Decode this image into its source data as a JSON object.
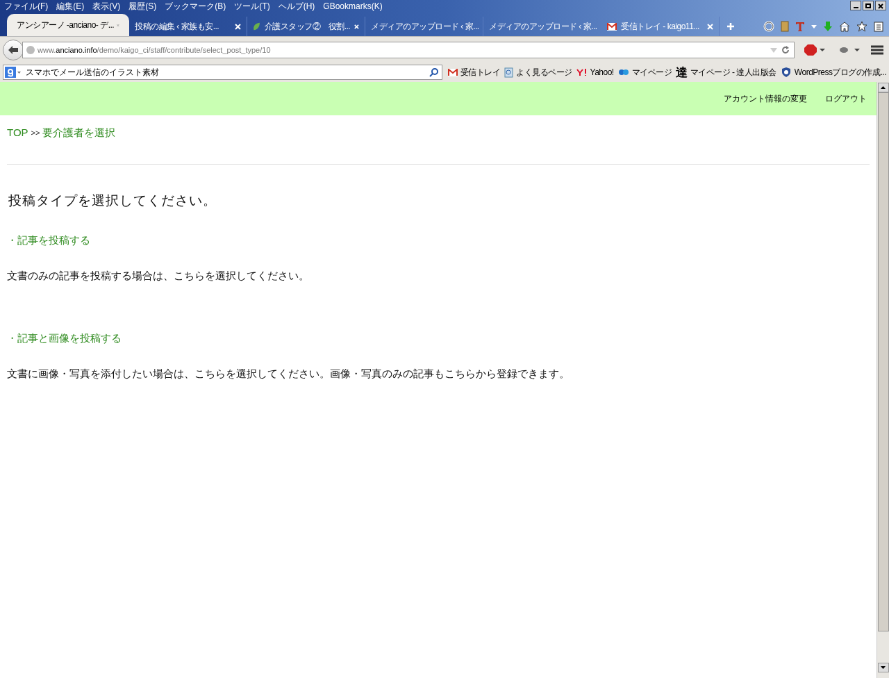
{
  "menu_bar": [
    "ファイル(F)",
    "編集(E)",
    "表示(V)",
    "履歴(S)",
    "ブックマーク(B)",
    "ツール(T)",
    "ヘルプ(H)",
    "GBookmarks(K)"
  ],
  "tabs": [
    {
      "label": "アンシアーノ -anciano- デ...",
      "selected": true,
      "kind": "plain"
    },
    {
      "label": "投稿の編集 ‹ 家族も安...",
      "selected": false,
      "kind": "plain"
    },
    {
      "label": "介護スタッフ②　役割...",
      "selected": false,
      "kind": "leaf"
    },
    {
      "label": "メディアのアップロード ‹ 家...",
      "selected": false,
      "kind": "plain"
    },
    {
      "label": "メディアのアップロード ‹ 家...",
      "selected": false,
      "kind": "plain"
    },
    {
      "label": "受信トレイ - kaigo11...",
      "selected": false,
      "kind": "mail"
    }
  ],
  "url": {
    "prefix": "www.",
    "domain": "anciano.info",
    "path": "/demo/kaigo_ci/staff/contribute/select_post_type/10"
  },
  "search": {
    "value": "スマホでメール送信のイラスト素材"
  },
  "bookmarks": [
    {
      "label": "受信トレイ",
      "kind": "mail"
    },
    {
      "label": "よく見るページ",
      "kind": "page"
    },
    {
      "label": "Yahoo!",
      "kind": "yahoo"
    },
    {
      "label": "マイページ",
      "kind": "dp"
    },
    {
      "label": "マイページ - 達人出版会",
      "kind": "glyph",
      "glyph": "達"
    },
    {
      "label": "WordPressブログの作成...",
      "kind": "shield"
    }
  ],
  "header_links": [
    "アカウント情報の変更",
    "ログアウト"
  ],
  "breadcrumb": {
    "top": "TOP",
    "separator": ">>",
    "current": "要介護者を選択"
  },
  "heading": "投稿タイプを選択してください。",
  "sections": [
    {
      "title": "・記事を投稿する",
      "description": "文書のみの記事を投稿する場合は、こちらを選択してください。"
    },
    {
      "title": "・記事と画像を投稿する",
      "description": "文書に画像・写真を添付したい場合は、こちらを選択してください。画像・写真のみの記事もこちらから登録できます。"
    }
  ]
}
